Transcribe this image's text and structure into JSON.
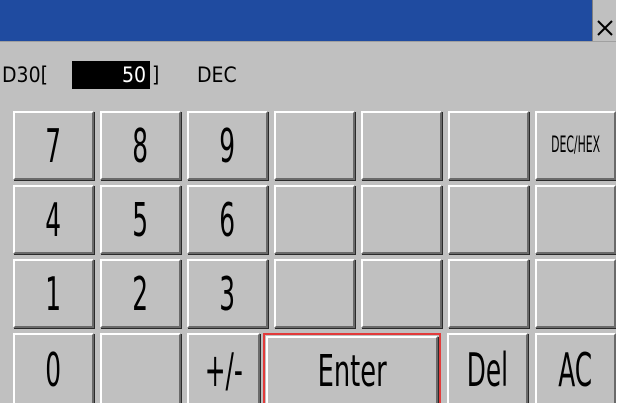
{
  "display": {
    "device": "D30",
    "open_bracket": "[",
    "value": "50",
    "close_bracket": "]",
    "mode": "DEC"
  },
  "keys": {
    "k7": "7",
    "k8": "8",
    "k9": "9",
    "dec_hex": "DEC/HEX",
    "k4": "4",
    "k5": "5",
    "k6": "6",
    "k1": "1",
    "k2": "2",
    "k3": "3",
    "k0": "0",
    "sign": "+/-",
    "enter": "Enter",
    "del": "Del",
    "ac": "AC"
  },
  "icons": {
    "close": "close-icon"
  },
  "colors": {
    "titlebar": "#1f4ba0",
    "panel": "#c0c0c0",
    "focus": "#e23b3b"
  }
}
